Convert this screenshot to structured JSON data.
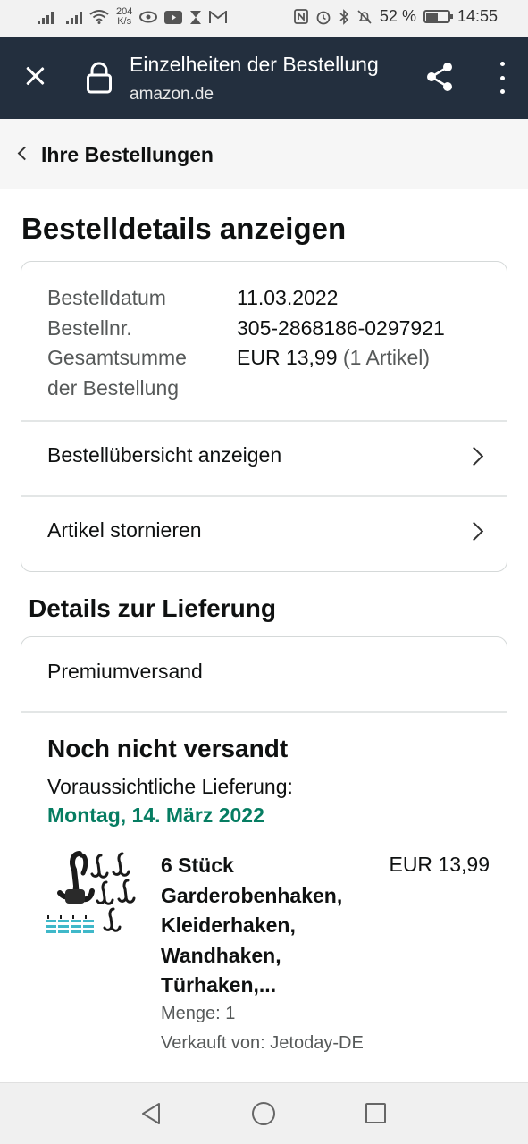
{
  "status_bar": {
    "net_speed_value": "204",
    "net_speed_unit": "K/s",
    "battery": "52 %",
    "battery_level": 0.52,
    "time": "14:55"
  },
  "header": {
    "title": "Einzelheiten der Bestellung",
    "url": "amazon.de",
    "close_icon": "close-icon",
    "lock_icon": "lock-icon",
    "share_icon": "share-icon",
    "menu_icon": "more-vertical-icon",
    "color": "#232f3e"
  },
  "breadcrumb": {
    "label": "Ihre Bestellungen"
  },
  "page_title": "Bestelldetails anzeigen",
  "order_summary": {
    "date_label": "Bestelldatum",
    "date_value": "11.03.2022",
    "number_label": "Bestellnr.",
    "number_value": "305-2868186-0297921",
    "total_label_line1": "Gesamtsumme",
    "total_label_line2": "der Bestellung",
    "total_value": "EUR 13,99",
    "total_items": "(1 Artikel)"
  },
  "links": {
    "overview": "Bestellübersicht anzeigen",
    "cancel": "Artikel stornieren"
  },
  "delivery": {
    "section_title": "Details zur Lieferung",
    "shipping_method": "Premiumversand",
    "status": "Noch nicht versandt",
    "eta_label": "Voraussichtliche Lieferung:",
    "eta_date": "Montag, 14. März 2022",
    "eta_color": "#067d62"
  },
  "item": {
    "name": "6 Stück Garderobenhaken, Kleiderhaken, Wandhaken, Türhaken,...",
    "price": "EUR 13,99",
    "quantity": "Menge: 1",
    "seller": "Verkauft von: Jetoday-DE"
  },
  "nav_bar": {
    "back_icon": "nav-back-icon",
    "home_icon": "nav-home-icon",
    "recents_icon": "nav-recents-icon"
  }
}
